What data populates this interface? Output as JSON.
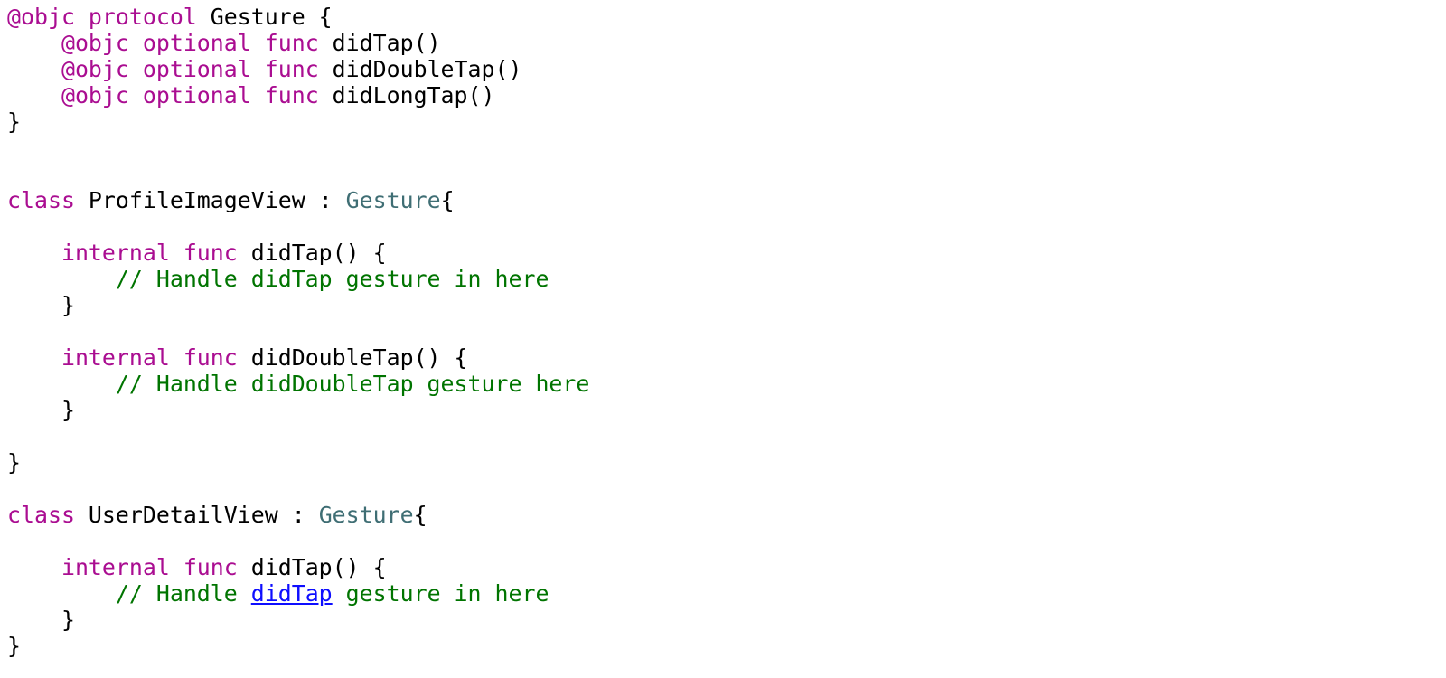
{
  "colors": {
    "keyword": "#aa0d91",
    "type": "#3f6e74",
    "plain": "#000000",
    "comment": "#007400",
    "link": "#0e0eff",
    "background": "#ffffff"
  },
  "code_lines": [
    [
      {
        "t": "kw",
        "v": "@objc protocol"
      },
      {
        "t": "plain",
        "v": " Gesture {"
      }
    ],
    [
      {
        "t": "plain",
        "v": "    "
      },
      {
        "t": "kw",
        "v": "@objc optional func"
      },
      {
        "t": "plain",
        "v": " didTap()"
      }
    ],
    [
      {
        "t": "plain",
        "v": "    "
      },
      {
        "t": "kw",
        "v": "@objc optional func"
      },
      {
        "t": "plain",
        "v": " didDoubleTap()"
      }
    ],
    [
      {
        "t": "plain",
        "v": "    "
      },
      {
        "t": "kw",
        "v": "@objc optional func"
      },
      {
        "t": "plain",
        "v": " didLongTap()"
      }
    ],
    [
      {
        "t": "plain",
        "v": "}"
      }
    ],
    [],
    [],
    [
      {
        "t": "kw",
        "v": "class"
      },
      {
        "t": "plain",
        "v": " ProfileImageView : "
      },
      {
        "t": "type",
        "v": "Gesture"
      },
      {
        "t": "plain",
        "v": "{"
      }
    ],
    [],
    [
      {
        "t": "plain",
        "v": "    "
      },
      {
        "t": "kw",
        "v": "internal func"
      },
      {
        "t": "plain",
        "v": " didTap() {"
      }
    ],
    [
      {
        "t": "plain",
        "v": "        "
      },
      {
        "t": "cmt",
        "v": "// Handle didTap gesture in here"
      }
    ],
    [
      {
        "t": "plain",
        "v": "    }"
      }
    ],
    [],
    [
      {
        "t": "plain",
        "v": "    "
      },
      {
        "t": "kw",
        "v": "internal func"
      },
      {
        "t": "plain",
        "v": " didDoubleTap() {"
      }
    ],
    [
      {
        "t": "plain",
        "v": "        "
      },
      {
        "t": "cmt",
        "v": "// Handle didDoubleTap gesture here"
      }
    ],
    [
      {
        "t": "plain",
        "v": "    }"
      }
    ],
    [],
    [
      {
        "t": "plain",
        "v": "}"
      }
    ],
    [],
    [
      {
        "t": "kw",
        "v": "class"
      },
      {
        "t": "plain",
        "v": " UserDetailView : "
      },
      {
        "t": "type",
        "v": "Gesture"
      },
      {
        "t": "plain",
        "v": "{"
      }
    ],
    [],
    [
      {
        "t": "plain",
        "v": "    "
      },
      {
        "t": "kw",
        "v": "internal func"
      },
      {
        "t": "plain",
        "v": " didTap() {"
      }
    ],
    [
      {
        "t": "plain",
        "v": "        "
      },
      {
        "t": "cmt",
        "v": "// Handle "
      },
      {
        "t": "link",
        "v": "didTap"
      },
      {
        "t": "cmt",
        "v": " gesture in here"
      }
    ],
    [
      {
        "t": "plain",
        "v": "    }"
      }
    ],
    [
      {
        "t": "plain",
        "v": "}"
      }
    ]
  ]
}
